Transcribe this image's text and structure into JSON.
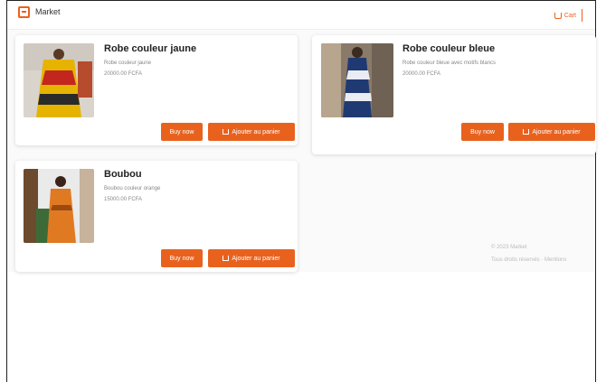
{
  "header": {
    "brand": "Market",
    "cart_label": "Cart"
  },
  "products": [
    {
      "title": "Robe couleur jaune",
      "description": "Robe couleur jaune",
      "price": "20000.00 FCFA",
      "buy_label": "Buy now",
      "add_label": "Ajouter au panier"
    },
    {
      "title": "Robe couleur bleue",
      "description": "Robe couleur bleue avec motifs blancs",
      "price": "20000.00 FCFA",
      "buy_label": "Buy now",
      "add_label": "Ajouter au panier"
    },
    {
      "title": "Boubou",
      "description": "Boubou couleur orange",
      "price": "15000.00 FCFA",
      "buy_label": "Buy now",
      "add_label": "Ajouter au panier"
    }
  ],
  "footer": {
    "line1": "© 2023 Market",
    "line2": "Tous droits réservés · Mentions"
  },
  "colors": {
    "accent": "#e8621e"
  },
  "icons": {
    "logo": "shop-logo-icon",
    "cart": "cart-icon"
  }
}
